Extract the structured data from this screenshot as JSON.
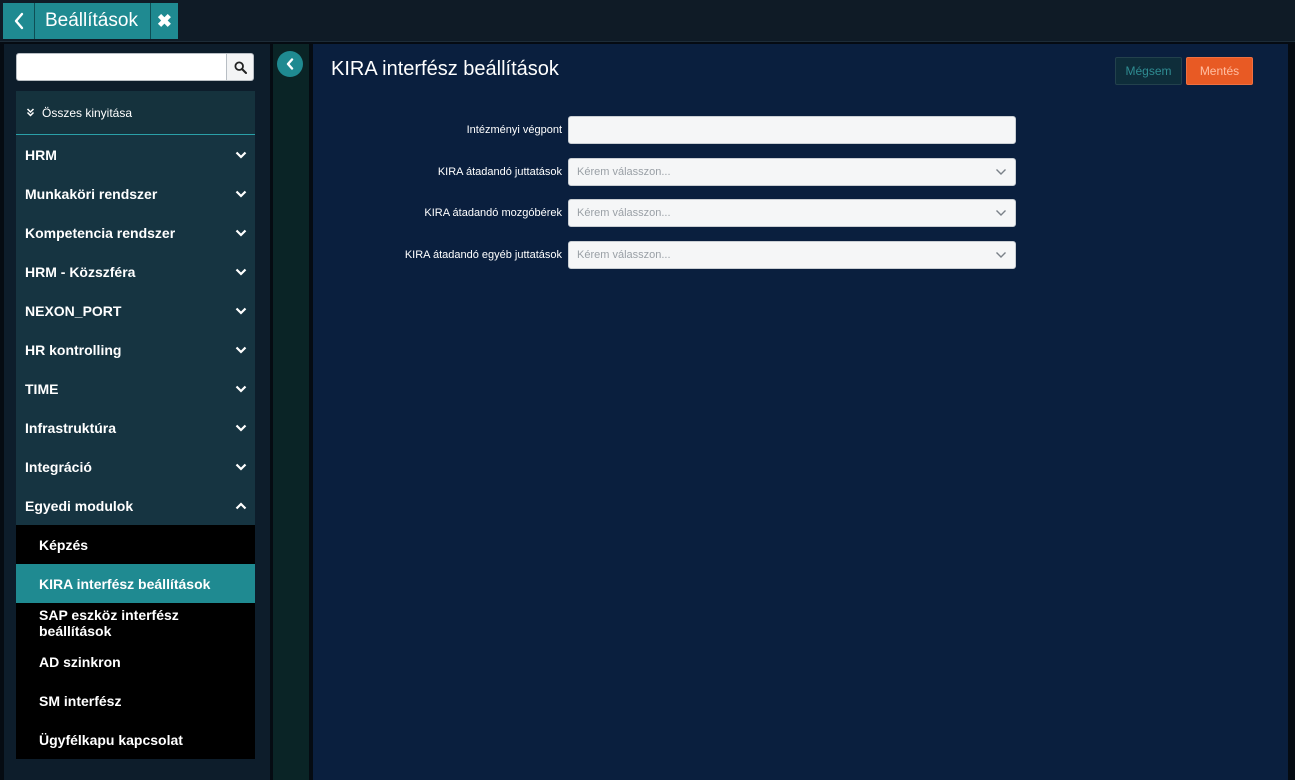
{
  "topbar": {
    "tab_title": "Beállítások"
  },
  "sidebar": {
    "search": {
      "placeholder": "",
      "value": ""
    },
    "expand_all_label": "Összes kinyitása",
    "items": [
      {
        "label": "HRM",
        "expanded": false
      },
      {
        "label": "Munkaköri rendszer",
        "expanded": false
      },
      {
        "label": "Kompetencia rendszer",
        "expanded": false
      },
      {
        "label": "HRM - Közszféra",
        "expanded": false
      },
      {
        "label": "NEXON_PORT",
        "expanded": false
      },
      {
        "label": "HR kontrolling",
        "expanded": false
      },
      {
        "label": "TIME",
        "expanded": false
      },
      {
        "label": "Infrastruktúra",
        "expanded": false
      },
      {
        "label": "Integráció",
        "expanded": false
      },
      {
        "label": "Egyedi modulok",
        "expanded": true
      }
    ],
    "sub_items": [
      {
        "label": "Képzés",
        "active": false
      },
      {
        "label": "KIRA interfész beállítások",
        "active": true
      },
      {
        "label": "SAP eszköz interfész beállítások",
        "active": false
      },
      {
        "label": "AD szinkron",
        "active": false
      },
      {
        "label": "SM interfész",
        "active": false
      },
      {
        "label": "Ügyfélkapu kapcsolat",
        "active": false
      }
    ]
  },
  "main": {
    "title": "KIRA interfész beállítások",
    "cancel_label": "Mégsem",
    "save_label": "Mentés",
    "fields": [
      {
        "label": "Intézményi végpont",
        "type": "text",
        "value": ""
      },
      {
        "label": "KIRA átadandó juttatások",
        "type": "select",
        "placeholder": "Kérem válasszon..."
      },
      {
        "label": "KIRA átadandó mozgóbérek",
        "type": "select",
        "placeholder": "Kérem válasszon..."
      },
      {
        "label": "KIRA átadandó egyéb juttatások",
        "type": "select",
        "placeholder": "Kérem válasszon..."
      }
    ]
  },
  "colors": {
    "accent": "#1f8a91",
    "save": "#e85a24",
    "main_bg": "#0a1f3e",
    "sidebar_item_bg": "#163441"
  }
}
